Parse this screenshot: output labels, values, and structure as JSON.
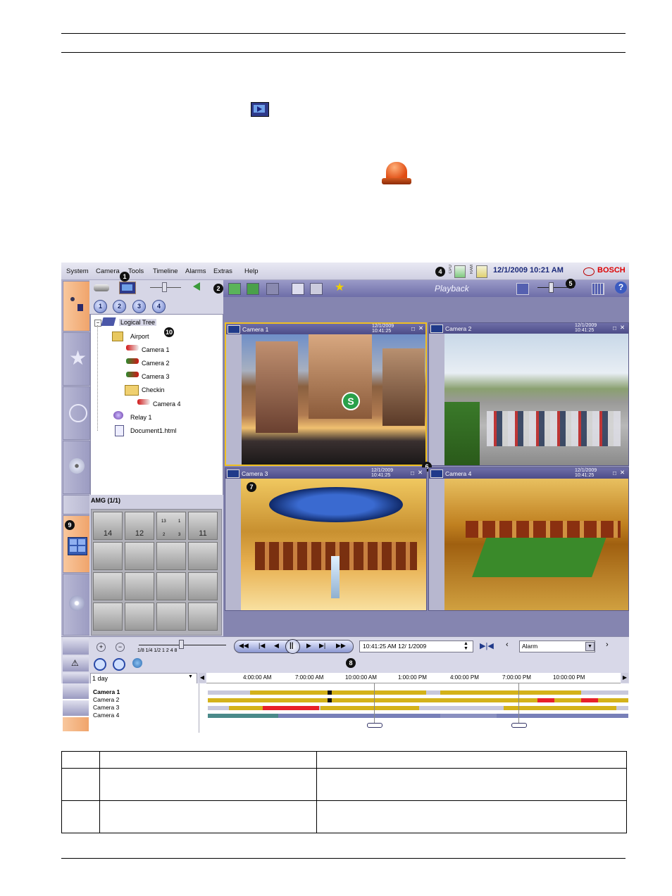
{
  "app": {
    "menu": [
      "System",
      "Camera",
      "Tools",
      "Timeline",
      "Alarms",
      "Extras",
      "Help"
    ],
    "datetime": "12/1/2009 10:21 AM",
    "cpu_label": "CPU",
    "ram_label": "RAM",
    "brand": "BOSCH",
    "mode_title": "Playback",
    "tree": {
      "root": "Logical Tree",
      "items": [
        "Airport",
        "Camera 1",
        "Camera 2",
        "Camera 3",
        "Checkin",
        "Camera 4",
        "Relay 1",
        "Document1.html"
      ]
    },
    "quick_buttons": [
      "1",
      "2",
      "3",
      "4"
    ],
    "monitor_group": {
      "title": "AMG (1/1)",
      "monitors": [
        "14",
        "12",
        "",
        "11"
      ],
      "split_numbers": [
        "13",
        "1",
        "2",
        "3"
      ]
    },
    "cameras": [
      {
        "title": "Camera 1",
        "date": "12/1/2009",
        "time": "10:41:25"
      },
      {
        "title": "Camera 2",
        "date": "12/1/2009",
        "time": "10:41:25"
      },
      {
        "title": "Camera 3",
        "date": "12/1/2009",
        "time": "10:41:25"
      },
      {
        "title": "Camera 4",
        "date": "12/1/2009",
        "time": "10:41:25"
      }
    ],
    "playback": {
      "speeds": "1/8 1/4 1/2  1   2   4   8",
      "time_value": "10:41:25 AM 12/ 1/2009",
      "search_type": "Alarm"
    },
    "timeline": {
      "range": "1 day",
      "ticks": [
        "4:00:00 AM",
        "7:00:00 AM",
        "10:00:00 AM",
        "1:00:00 PM",
        "4:00:00 PM",
        "7:00:00 PM",
        "10:00:00 PM"
      ],
      "tracks": [
        "Camera 1",
        "Camera 2",
        "Camera 3",
        "Camera 4"
      ]
    },
    "callouts": [
      "1",
      "2",
      "4",
      "5",
      "6",
      "7",
      "8",
      "9",
      "10"
    ],
    "colors": {
      "recording": "#d4b21a",
      "alarm": "#e8202a",
      "motion": "#7880b8",
      "gap": "#c8c8dc",
      "accent": "#f0a46b"
    }
  }
}
